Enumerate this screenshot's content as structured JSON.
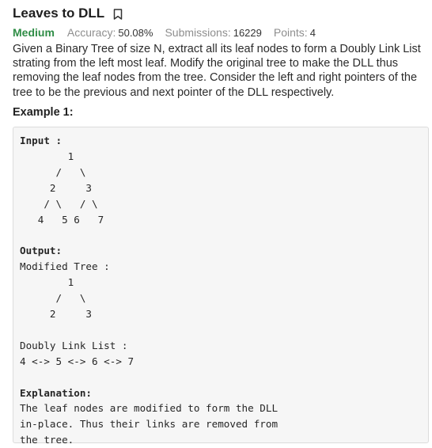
{
  "problem": {
    "title": "Leaves to DLL",
    "difficulty": "Medium",
    "accuracy_label": "Accuracy:",
    "accuracy_value": "50.08%",
    "submissions_label": "Submissions:",
    "submissions_value": "16229",
    "points_label": "Points:",
    "points_value": "4",
    "bookmark_icon": "bookmark-icon"
  },
  "description": "Given a Binary Tree of size N, extract all its leaf nodes to form a Doubly Link List strating from the left most leaf. Modify the original tree to make the DLL thus removing the leaf nodes from the tree. Consider the left and right pointers of the tree to be the previous and next pointer of the DLL respectively.",
  "example": {
    "title": "Example 1:",
    "input_label": "Input :",
    "input_tree": "        1\n      /   \\\n     2     3\n    / \\   / \\\n   4   5 6   7",
    "output_label": "Output:",
    "modified_tree_label": "Modified Tree :",
    "modified_tree": "        1\n      /   \\\n     2     3",
    "dll_label": "Doubly Link List :",
    "dll_value": "4 <-> 5 <-> 6 <-> 7",
    "explanation_label": "Explanation:",
    "explanation_text": "The leaf nodes are modified to form the DLL\nin-place. Thus their links are removed from\nthe tree."
  }
}
